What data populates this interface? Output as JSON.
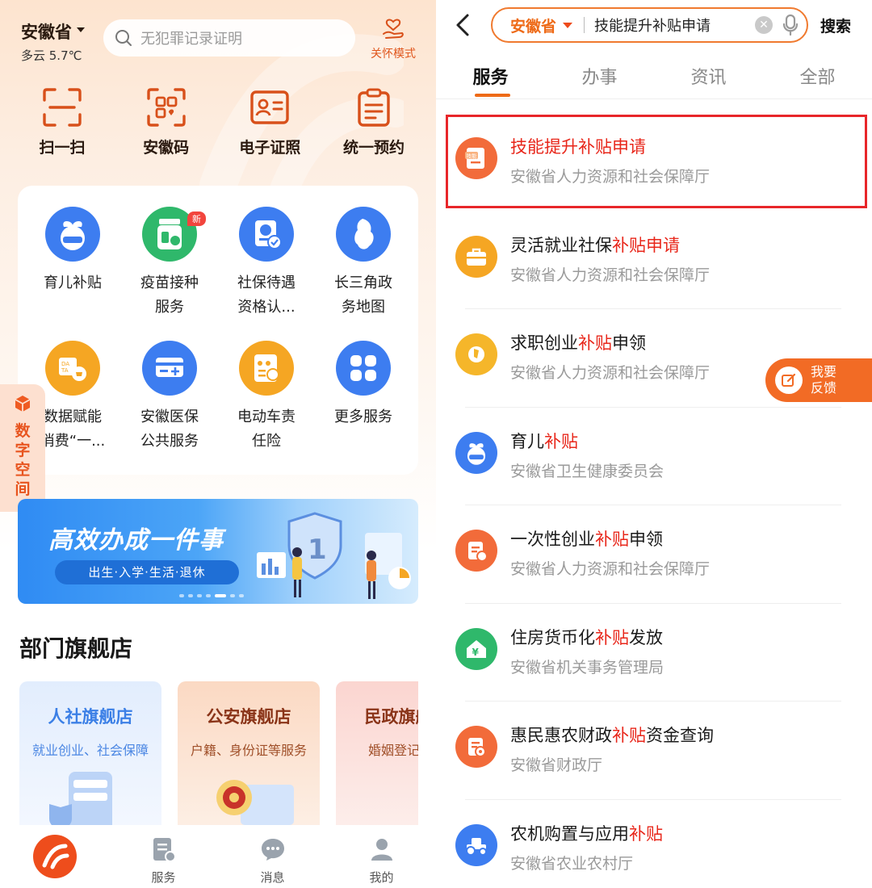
{
  "left": {
    "location": {
      "province": "安徽省",
      "weather": "多云 5.7℃"
    },
    "search": {
      "placeholder": "无犯罪记录证明"
    },
    "care_mode": {
      "label": "关怀模式"
    },
    "quick_actions": [
      {
        "label": "扫一扫",
        "icon": "scan-icon"
      },
      {
        "label": "安徽码",
        "icon": "qr-code-icon"
      },
      {
        "label": "电子证照",
        "icon": "id-card-icon"
      },
      {
        "label": "统一预约",
        "icon": "clipboard-icon"
      }
    ],
    "services": [
      {
        "line1": "育儿补贴",
        "line2": "",
        "icon": "baby-subsidy-icon",
        "color": "#3d7df0"
      },
      {
        "line1": "疫苗接种",
        "line2": "服务",
        "icon": "vaccine-icon",
        "color": "#2fb86b",
        "badge": "新"
      },
      {
        "line1": "社保待遇",
        "line2": "资格认...",
        "icon": "social-security-icon",
        "color": "#3d7df0"
      },
      {
        "line1": "长三角政",
        "line2": "务地图",
        "icon": "map-icon",
        "color": "#3d7df0"
      },
      {
        "line1": "数据赋能",
        "line2": "消费“一...",
        "icon": "data-icon",
        "color": "#f5a623"
      },
      {
        "line1": "安徽医保",
        "line2": "公共服务",
        "icon": "medical-insurance-icon",
        "color": "#3d7df0"
      },
      {
        "line1": "电动车责",
        "line2": "任险",
        "icon": "ebike-insurance-icon",
        "color": "#f5a623"
      },
      {
        "line1": "更多服务",
        "line2": "",
        "icon": "more-icon",
        "color": "#3d7df0"
      }
    ],
    "digital_space": {
      "label": "数字空间"
    },
    "banner": {
      "title": "高效办成一件事",
      "subtitle": "出生·入学·生活·退休"
    },
    "dept_title": "部门旗舰店",
    "stores": [
      {
        "name": "人社旗舰店",
        "desc": "就业创业、社会保障",
        "color": "#3b7fe6",
        "bg": "#e9f1fd"
      },
      {
        "name": "公安旗舰店",
        "desc": "户籍、身份证等服务",
        "color": "#8a3418",
        "bg": "#fde7d9"
      },
      {
        "name": "民政旗舰店",
        "desc": "婚姻登记预约",
        "color": "#8a3418",
        "bg": "#fde5e2"
      }
    ],
    "tabbar": [
      {
        "label": "",
        "icon": "home-logo-icon"
      },
      {
        "label": "服务",
        "icon": "service-icon"
      },
      {
        "label": "消息",
        "icon": "message-icon"
      },
      {
        "label": "我的",
        "icon": "profile-icon"
      }
    ]
  },
  "right": {
    "search": {
      "province": "安徽省",
      "query": "技能提升补贴申请",
      "button": "搜索"
    },
    "tabs": [
      "服务",
      "办事",
      "资讯",
      "全部"
    ],
    "results": [
      {
        "pre": "技能提升补贴申请",
        "hl": "",
        "post": "",
        "dept": "安徽省人力资源和社会保障厅",
        "icon": "skill-doc-icon",
        "color": "#f26b3a"
      },
      {
        "pre": "灵活就业社保",
        "hl": "补贴申请",
        "post": "",
        "dept": "安徽省人力资源和社会保障厅",
        "icon": "briefcase-icon",
        "color": "#f5a623"
      },
      {
        "pre": "求职创业",
        "hl": "补贴",
        "post": "申领",
        "dept": "安徽省人力资源和社会保障厅",
        "icon": "job-seek-icon",
        "color": "#f5b62a"
      },
      {
        "pre": "育儿",
        "hl": "补贴",
        "post": "",
        "dept": "安徽省卫生健康委员会",
        "icon": "baby-subsidy-icon",
        "color": "#3d7df0"
      },
      {
        "pre": "一次性创业",
        "hl": "补贴",
        "post": "申领",
        "dept": "安徽省人力资源和社会保障厅",
        "icon": "startup-doc-icon",
        "color": "#f26b3a"
      },
      {
        "pre": "住房货币化",
        "hl": "补贴",
        "post": "发放",
        "dept": "安徽省机关事务管理局",
        "icon": "housing-yuan-icon",
        "color": "#2fb86b"
      },
      {
        "pre": "惠民惠农财政",
        "hl": "补贴",
        "post": "资金查询",
        "dept": "安徽省财政厅",
        "icon": "finance-doc-icon",
        "color": "#f26b3a"
      },
      {
        "pre": "农机购置与应用",
        "hl": "补贴",
        "post": "",
        "dept": "安徽省农业农村厅",
        "icon": "tractor-icon",
        "color": "#3d7df0"
      }
    ],
    "feedback": {
      "line1": "我要",
      "line2": "反馈"
    }
  }
}
